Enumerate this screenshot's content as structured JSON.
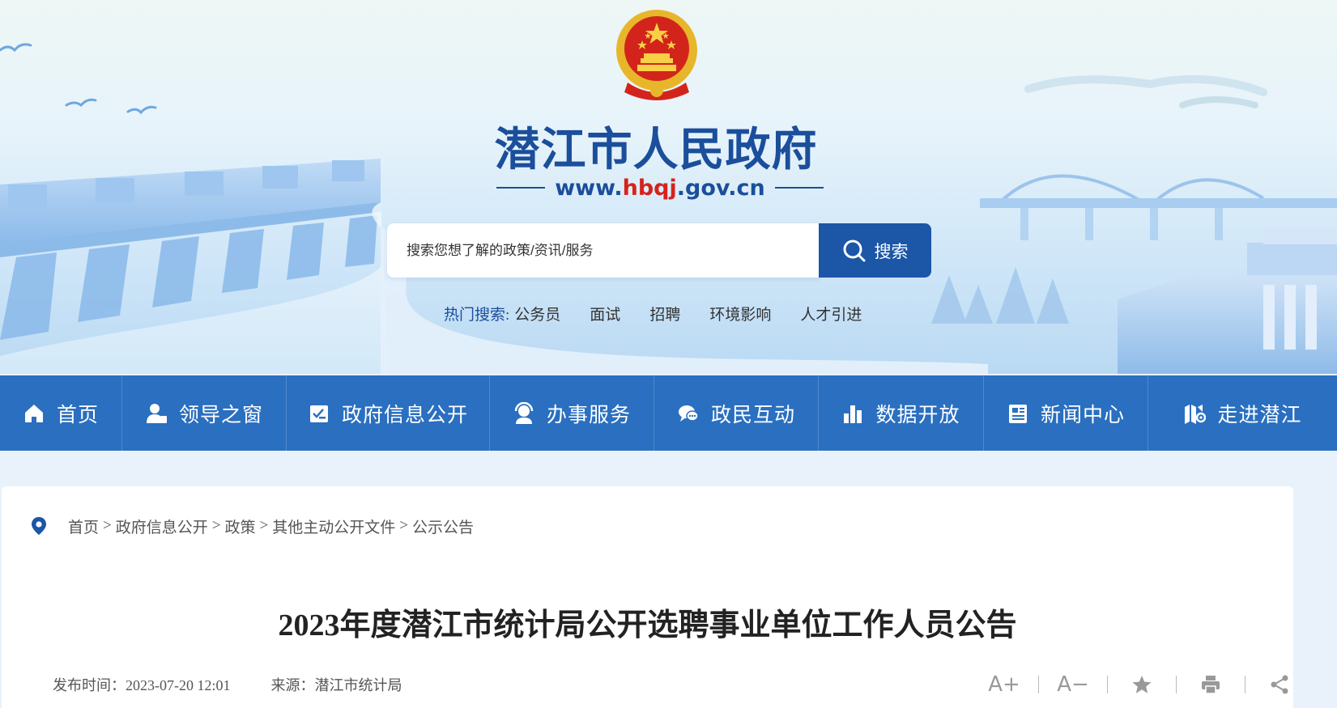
{
  "header": {
    "site_title": "潜江市人民政府",
    "site_url_prefix": "www.",
    "site_url_highlight": "hbqj",
    "site_url_suffix": ".gov.cn"
  },
  "search": {
    "placeholder": "搜索您想了解的政策/资讯/服务",
    "button_label": "搜索"
  },
  "hot_search": {
    "label": "热门搜索:",
    "items": [
      "公务员",
      "面试",
      "招聘",
      "环境影响",
      "人才引进"
    ]
  },
  "nav": {
    "items": [
      {
        "label": "首页",
        "icon": "home-icon"
      },
      {
        "label": "领导之窗",
        "icon": "leader-icon"
      },
      {
        "label": "政府信息公开",
        "icon": "info-disclosure-icon"
      },
      {
        "label": "办事服务",
        "icon": "service-icon"
      },
      {
        "label": "政民互动",
        "icon": "chat-icon"
      },
      {
        "label": "数据开放",
        "icon": "bar-chart-icon"
      },
      {
        "label": "新闻中心",
        "icon": "news-icon"
      },
      {
        "label": "走进潜江",
        "icon": "map-icon"
      }
    ]
  },
  "breadcrumb": [
    "首页",
    "政府信息公开",
    "政策",
    "其他主动公开文件",
    "公示公告"
  ],
  "breadcrumb_separator": ">",
  "article": {
    "title": "2023年度潜江市统计局公开选聘事业单位工作人员公告",
    "publish_label": "发布时间：",
    "publish_time": "2023-07-20 12:01",
    "source_label": "来源：",
    "source": "潜江市统计局"
  },
  "tools": {
    "font_increase": "A+",
    "font_decrease": "A−"
  },
  "colors": {
    "brand_blue": "#1b4e9b",
    "nav_blue": "#2a6fc0",
    "search_button": "#1b56a7",
    "url_red": "#d5231c"
  }
}
